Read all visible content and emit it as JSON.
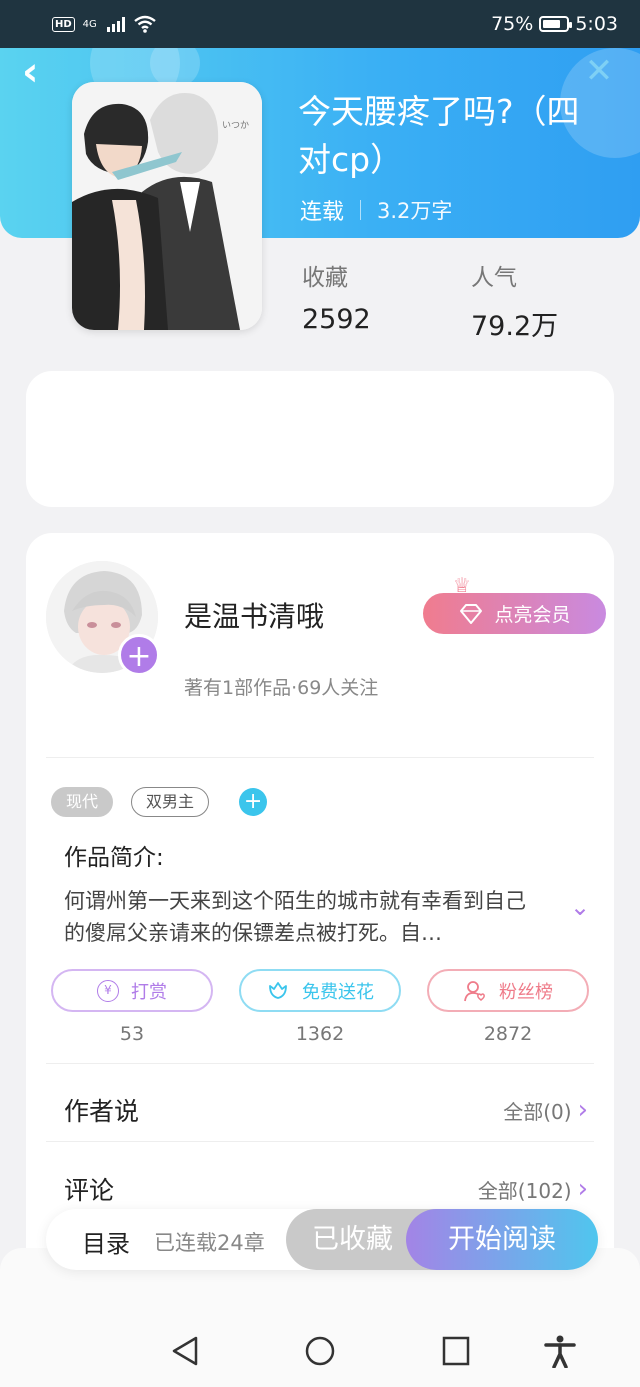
{
  "status_bar": {
    "hd": "HD",
    "network": "4G",
    "battery_percent": "75%",
    "battery_level": 0.75,
    "time": "5:03"
  },
  "book": {
    "title": "今天腰疼了吗?（四对cp）",
    "status": "连载",
    "word_count": "3.2万字",
    "favorites_label": "收藏",
    "favorites_value": "2592",
    "popularity_label": "人气",
    "popularity_value": "79.2万"
  },
  "author": {
    "name": "是温书清哦",
    "subtitle": "著有1部作品·69人关注",
    "vip_label": "点亮会员"
  },
  "tags": [
    "现代",
    "双男主"
  ],
  "intro": {
    "heading": "作品简介:",
    "text": "何谓州第一天来到这个陌生的城市就有幸看到自己的傻屌父亲请来的保镖差点被打死。自…"
  },
  "actions": [
    {
      "label": "打赏",
      "count": "53",
      "color": "#b07ce8",
      "icon": "yen-coin-icon"
    },
    {
      "label": "免费送花",
      "count": "1362",
      "color": "#3bc5ec",
      "icon": "flower-icon"
    },
    {
      "label": "粉丝榜",
      "count": "2872",
      "color": "#ef7c8a",
      "icon": "fan-person-icon"
    }
  ],
  "author_says": {
    "label": "作者说",
    "link": "全部(0)"
  },
  "comments": {
    "label": "评论",
    "link": "全部(102)"
  },
  "bottom_bar": {
    "toc": "目录",
    "chapters": "已连载24章",
    "collected": "已收藏",
    "start_read": "开始阅读"
  },
  "colors": {
    "header_start": "#5ad3f0",
    "header_end": "#2f9ef2",
    "accent_purple": "#b07ce8",
    "accent_blue": "#3bc5ec"
  }
}
